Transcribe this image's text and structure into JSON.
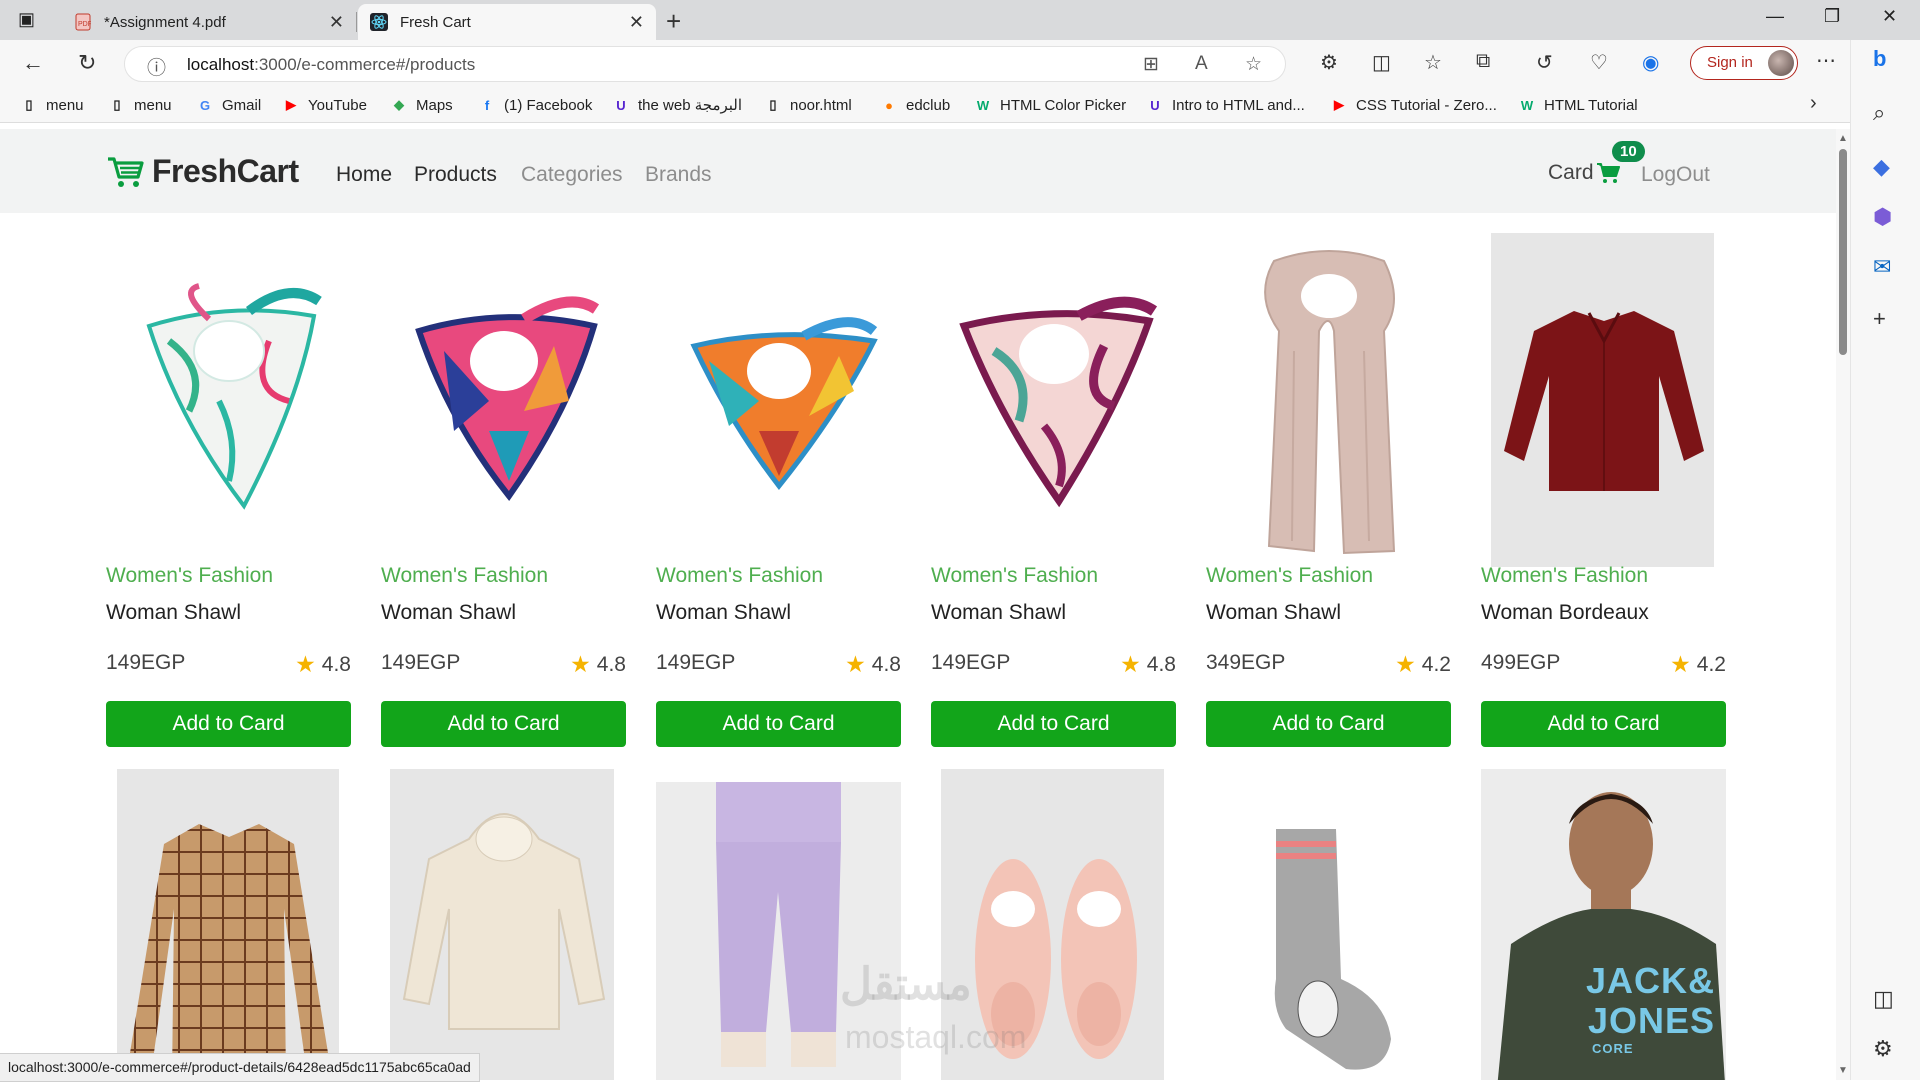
{
  "browser": {
    "tabs": [
      {
        "title": "*Assignment 4.pdf",
        "icon": "pdf-icon"
      },
      {
        "title": "Fresh Cart",
        "icon": "react-icon"
      }
    ],
    "url_host": "localhost",
    "url_path": ":3000/e-commerce#/products",
    "sign_in": "Sign in",
    "bookmarks": [
      {
        "label": "menu",
        "icon": "page-icon"
      },
      {
        "label": "menu",
        "icon": "page-icon"
      },
      {
        "label": "Gmail",
        "icon": "google-icon"
      },
      {
        "label": "YouTube",
        "icon": "youtube-icon"
      },
      {
        "label": "Maps",
        "icon": "maps-icon"
      },
      {
        "label": "(1) Facebook",
        "icon": "facebook-icon"
      },
      {
        "label": "the web البرمجة",
        "icon": "udemy-icon"
      },
      {
        "label": "noor.html",
        "icon": "page-icon"
      },
      {
        "label": "edclub",
        "icon": "edclub-icon"
      },
      {
        "label": "HTML Color Picker",
        "icon": "w3schools-icon"
      },
      {
        "label": "Intro to HTML and...",
        "icon": "udemy-icon"
      },
      {
        "label": "CSS Tutorial - Zero...",
        "icon": "youtube-icon"
      },
      {
        "label": "HTML Tutorial",
        "icon": "w3schools-icon"
      }
    ],
    "status_url": "localhost:3000/e-commerce#/product-details/6428ead5dc1175abc65ca0ad"
  },
  "navbar": {
    "brand": "FreshCart",
    "links": [
      "Home",
      "Products",
      "Categories",
      "Brands"
    ],
    "cart_label": "Card",
    "cart_count": "10",
    "logout": "LogOut"
  },
  "products": [
    {
      "category": "Women's Fashion",
      "title": "Woman Shawl",
      "price": "149EGP",
      "rating": "4.8",
      "button": "Add to Card"
    },
    {
      "category": "Women's Fashion",
      "title": "Woman Shawl",
      "price": "149EGP",
      "rating": "4.8",
      "button": "Add to Card"
    },
    {
      "category": "Women's Fashion",
      "title": "Woman Shawl",
      "price": "149EGP",
      "rating": "4.8",
      "button": "Add to Card"
    },
    {
      "category": "Women's Fashion",
      "title": "Woman Shawl",
      "price": "149EGP",
      "rating": "4.8",
      "button": "Add to Card"
    },
    {
      "category": "Women's Fashion",
      "title": "Woman Shawl",
      "price": "349EGP",
      "rating": "4.2",
      "button": "Add to Card"
    },
    {
      "category": "Women's Fashion",
      "title": "Woman Bordeaux",
      "price": "499EGP",
      "rating": "4.2",
      "button": "Add to Card"
    }
  ],
  "second_row_images": [
    "plaid-shirt",
    "cream-hoodie",
    "lavender-sweatpants",
    "pink-slippers",
    "grey-sock",
    "tshirt-model"
  ],
  "tshirt_print": [
    "JACK&",
    "JONES",
    "CORE"
  ],
  "watermark": [
    "مستقل",
    "mostaql.com"
  ],
  "colors": {
    "accent_green": "#12a51a",
    "category_green": "#4fae4f",
    "badge_green": "#0f8d4b"
  }
}
